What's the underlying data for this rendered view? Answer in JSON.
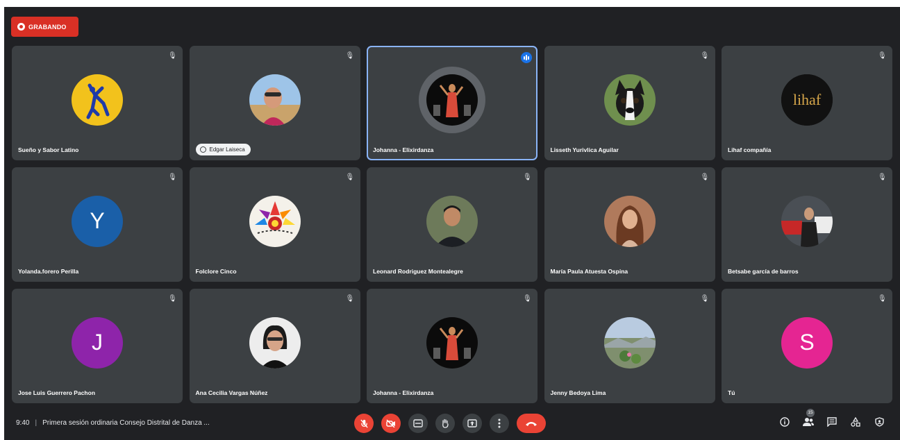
{
  "recording": {
    "label": "GRABANDO",
    "color": "#d93025"
  },
  "tiles": [
    {
      "name": "Sueño y Sabor Latino",
      "avatar": "logo-sueno-y-sabor",
      "avatar_text": "Sueño y Sabor Latino",
      "mic": "muted"
    },
    {
      "name": "Edgar Laiseca",
      "avatar": "photo-edgar",
      "mic": "muted",
      "name_style": "pill"
    },
    {
      "name": "Johanna - Elixirdanza",
      "avatar": "photo-dancer",
      "mic": "speaking",
      "active": true
    },
    {
      "name": "Lisseth Yurivlica Aguilar",
      "avatar": "photo-dog",
      "mic": "muted"
    },
    {
      "name": "Lihaf compañía",
      "avatar": "logo-lihaf",
      "avatar_text": "lihaf",
      "mic": "muted"
    },
    {
      "name": "Yolanda.forero Perilla",
      "avatar": "letter",
      "letter": "Y",
      "color": "#1a5fa8",
      "mic": "muted"
    },
    {
      "name": "Folclore Cinco",
      "avatar": "logo-folclore",
      "mic": "muted"
    },
    {
      "name": "Leonard Rodriguez Montealegre",
      "avatar": "photo-man",
      "mic": "muted"
    },
    {
      "name": "María Paula Atuesta Ospina",
      "avatar": "photo-woman",
      "mic": "muted"
    },
    {
      "name": "Betsabe garcía de barros",
      "avatar": "photo-betsabe",
      "mic": "muted"
    },
    {
      "name": "Jose Luis Guerrero Pachon",
      "avatar": "letter",
      "letter": "J",
      "color": "#8e24aa",
      "mic": "muted"
    },
    {
      "name": "Ana Cecilia Vargas Núñez",
      "avatar": "photo-ana",
      "mic": "muted"
    },
    {
      "name": "Johanna - Elixirdanza",
      "avatar": "photo-dancer",
      "mic": "muted"
    },
    {
      "name": "Jenny Bedoya Lima",
      "avatar": "photo-landscape",
      "mic": "muted"
    },
    {
      "name": "Tú",
      "avatar": "letter",
      "letter": "S",
      "color": "#e52592",
      "mic": "muted"
    }
  ],
  "footer": {
    "time": "9:40",
    "separator": "|",
    "meeting_title": "Primera sesión ordinaria Consejo Distrital de Danza ...",
    "participants_count": "15"
  },
  "controls": [
    "mic-off-icon",
    "camera-off-icon",
    "captions-icon",
    "raise-hand-icon",
    "present-icon",
    "more-options-icon",
    "end-call-icon"
  ],
  "right_controls": [
    "info-icon",
    "people-icon",
    "chat-icon",
    "activities-icon",
    "host-controls-icon"
  ]
}
